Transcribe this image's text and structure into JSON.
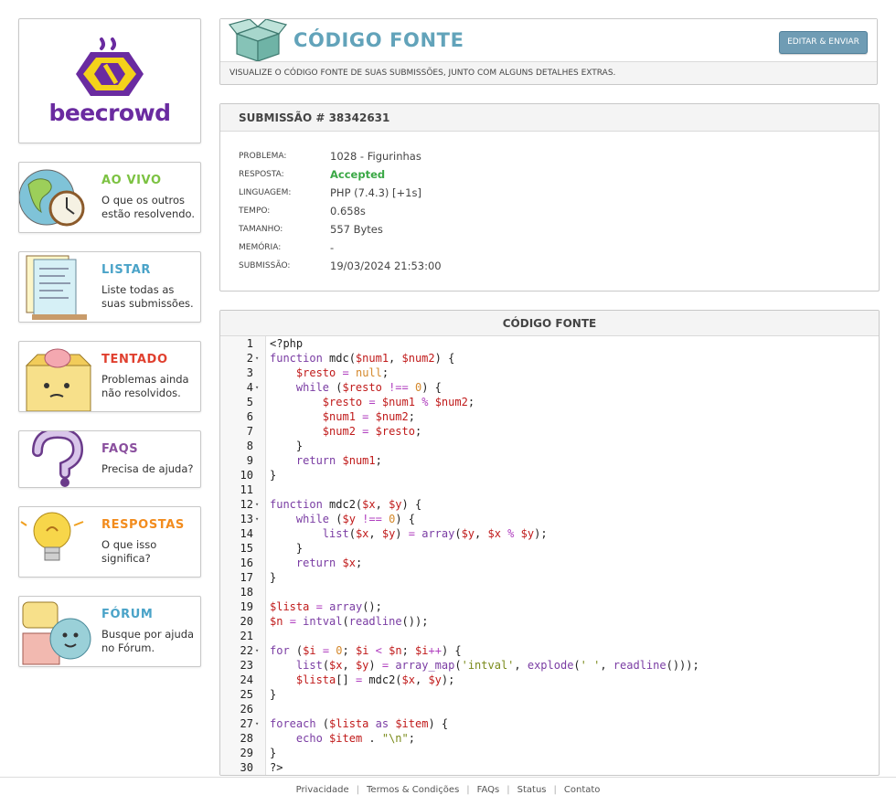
{
  "brand": {
    "name": "beecrowd"
  },
  "sidebar": {
    "items": [
      {
        "title": "AO VIVO",
        "desc": "O que os outros estão resolvendo.",
        "color": "#7cc242",
        "icon": "globe-clock-icon"
      },
      {
        "title": "LISTAR",
        "desc": "Liste todas as suas submissões.",
        "color": "#4aa3c8",
        "icon": "notes-list-icon"
      },
      {
        "title": "TENTADO",
        "desc": "Problemas ainda não resolvidos.",
        "color": "#e0402f",
        "icon": "box-brain-icon"
      },
      {
        "title": "FAQS",
        "desc": "Precisa de ajuda?",
        "color": "#8a4f9e",
        "icon": "question-mark-icon"
      },
      {
        "title": "RESPOSTAS",
        "desc": "O que isso significa?",
        "color": "#f28c1e",
        "icon": "lightbulb-icon"
      },
      {
        "title": "FÓRUM",
        "desc": "Busque por ajuda no Fórum.",
        "color": "#4aa3c8",
        "icon": "forum-chat-icon"
      }
    ]
  },
  "header": {
    "title": "CÓDIGO FONTE",
    "button": "EDITAR & ENVIAR",
    "subtitle": "VISUALIZE O CÓDIGO FONTE DE SUAS SUBMISSÕES, JUNTO COM ALGUNS DETALHES EXTRAS."
  },
  "submission": {
    "heading": "SUBMISSÃO # 38342631",
    "fields": [
      {
        "label": "PROBLEMA:",
        "value": "1028 - Figurinhas"
      },
      {
        "label": "RESPOSTA:",
        "value": "Accepted"
      },
      {
        "label": "LINGUAGEM:",
        "value": "PHP (7.4.3) [+1s]"
      },
      {
        "label": "TEMPO:",
        "value": "0.658s"
      },
      {
        "label": "TAMANHO:",
        "value": "557 Bytes"
      },
      {
        "label": "MEMÓRIA:",
        "value": "-"
      },
      {
        "label": "SUBMISSÃO:",
        "value": "19/03/2024 21:53:00"
      }
    ]
  },
  "code": {
    "heading": "CÓDIGO FONTE",
    "lines": [
      "<?php",
      "function mdc($num1, $num2) {",
      "    $resto = null;",
      "    while ($resto !== 0) {",
      "        $resto = $num1 % $num2;",
      "        $num1 = $num2;",
      "        $num2 = $resto;",
      "    }",
      "    return $num1;",
      "}",
      "",
      "function mdc2($x, $y) {",
      "    while ($y !== 0) {",
      "        list($x, $y) = array($y, $x % $y);",
      "    }",
      "    return $x;",
      "}",
      "",
      "$lista = array();",
      "$n = intval(readline());",
      "",
      "for ($i = 0; $i < $n; $i++) {",
      "    list($x, $y) = array_map('intval', explode(' ', readline()));",
      "    $lista[] = mdc2($x, $y);",
      "}",
      "",
      "foreach ($lista as $item) {",
      "    echo $item . \"\\n\";",
      "}",
      "?>"
    ],
    "foldable_lines": [
      2,
      4,
      12,
      13,
      22,
      27
    ]
  },
  "footer": {
    "links": [
      "Privacidade",
      "Termos & Condições",
      "FAQs",
      "Status",
      "Contato"
    ]
  }
}
